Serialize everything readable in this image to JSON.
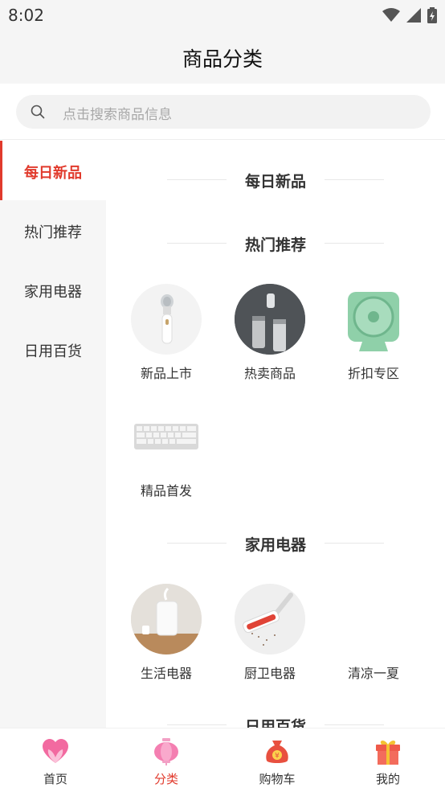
{
  "status_bar": {
    "time": "8:02"
  },
  "header": {
    "title": "商品分类"
  },
  "search": {
    "placeholder": "点击搜索商品信息"
  },
  "sidebar": {
    "items": [
      {
        "label": "每日新品",
        "active": true
      },
      {
        "label": "热门推荐",
        "active": false
      },
      {
        "label": "家用电器",
        "active": false
      },
      {
        "label": "日用百货",
        "active": false
      }
    ]
  },
  "sections": [
    {
      "title": "每日新品",
      "items": []
    },
    {
      "title": "热门推荐",
      "items": [
        {
          "label": "新品上市",
          "icon": "face-cleansing-brush"
        },
        {
          "label": "热卖商品",
          "icon": "thermos-cups"
        },
        {
          "label": "折扣专区",
          "icon": "desk-fan"
        },
        {
          "label": "精品首发",
          "icon": "keyboard"
        }
      ]
    },
    {
      "title": "家用电器",
      "items": [
        {
          "label": "生活电器",
          "icon": "humidifier"
        },
        {
          "label": "厨卫电器",
          "icon": "vacuum-brush"
        },
        {
          "label": "清凉一夏",
          "icon": ""
        }
      ]
    },
    {
      "title": "日用百货",
      "items": []
    }
  ],
  "tabbar": {
    "items": [
      {
        "label": "首页",
        "icon": "heart-icon",
        "active": false
      },
      {
        "label": "分类",
        "icon": "lantern-icon",
        "active": true
      },
      {
        "label": "购物车",
        "icon": "money-bag-icon",
        "active": false
      },
      {
        "label": "我的",
        "icon": "gift-icon",
        "active": false
      }
    ]
  },
  "colors": {
    "accent": "#e13a2c",
    "sidebar_bg": "#f6f6f6",
    "header_bg": "#f5f5f5"
  }
}
